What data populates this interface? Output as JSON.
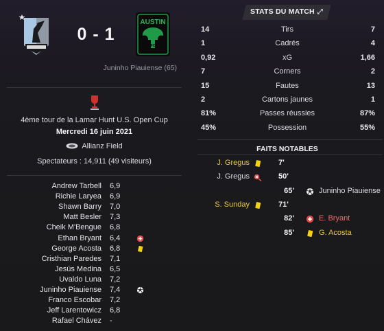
{
  "match": {
    "score": "0 - 1",
    "scorer_note": "Juninho Piauiense (65)",
    "competition": "4ème tour de la Lamar Hunt U.S. Open Cup",
    "date": "Mercredi 16 juin 2021",
    "venue": "Allianz Field",
    "attendance": "Spectateurs : 14,911 (49 visiteurs)",
    "away_crest_text": "AUSTIN",
    "away_crest_sub": "FC",
    "colors": {
      "yellow_card": "#f2d211",
      "red_text": "#ee6b6b",
      "away_green": "#1e9a49",
      "gold_text": "#e8c840"
    }
  },
  "players": [
    {
      "name": "Andrew Tarbell",
      "rating": "6,9",
      "event": ""
    },
    {
      "name": "Richie Laryea",
      "rating": "6,9",
      "event": ""
    },
    {
      "name": "Shawn Barry",
      "rating": "7,0",
      "event": ""
    },
    {
      "name": "Matt Besler",
      "rating": "7,3",
      "event": ""
    },
    {
      "name": "Cheik M'Bengue",
      "rating": "6,8",
      "event": ""
    },
    {
      "name": "Ethan Bryant",
      "rating": "6,4",
      "event": "substitution-red-icon"
    },
    {
      "name": "George Acosta",
      "rating": "6,8",
      "event": "yellow-card-icon"
    },
    {
      "name": "Cristhian Paredes",
      "rating": "7,1",
      "event": ""
    },
    {
      "name": "Jesús Medina",
      "rating": "6,5",
      "event": ""
    },
    {
      "name": "Uvaldo Luna",
      "rating": "7,2",
      "event": ""
    },
    {
      "name": "Juninho Piauiense",
      "rating": "7,4",
      "event": "ball-icon"
    },
    {
      "name": "Franco Escobar",
      "rating": "7,2",
      "event": ""
    },
    {
      "name": "Jeff Larentowicz",
      "rating": "6,8",
      "event": ""
    },
    {
      "name": "Rafael Chávez",
      "rating": "-",
      "event": ""
    }
  ],
  "stats": {
    "title": "STATS DU MATCH",
    "rows": [
      {
        "home": "14",
        "label": "Tirs",
        "away": "7"
      },
      {
        "home": "1",
        "label": "Cadrés",
        "away": "4"
      },
      {
        "home": "0,92",
        "label": "xG",
        "away": "1,66"
      },
      {
        "home": "7",
        "label": "Corners",
        "away": "2"
      },
      {
        "home": "15",
        "label": "Fautes",
        "away": "13"
      },
      {
        "home": "2",
        "label": "Cartons jaunes",
        "away": "1"
      },
      {
        "home": "81%",
        "label": "Passes réussies",
        "away": "87%"
      },
      {
        "home": "45%",
        "label": "Possession",
        "away": "55%"
      }
    ]
  },
  "events": {
    "title": "FAITS NOTABLES",
    "rows": [
      {
        "minute": "7'",
        "home_name": "J. Gregus",
        "home_icon": "yellow-card-icon",
        "away_name": "",
        "away_icon": "",
        "name_color": "gold"
      },
      {
        "minute": "50'",
        "home_name": "J. Gregus",
        "home_icon": "missed-chance-icon",
        "away_name": "",
        "away_icon": "",
        "name_color": "white"
      },
      {
        "minute": "65'",
        "home_name": "",
        "home_icon": "",
        "away_name": "Juninho Piauiense",
        "away_icon": "ball-icon",
        "name_color": "white"
      },
      {
        "minute": "71'",
        "home_name": "S. Sunday",
        "home_icon": "yellow-card-icon",
        "away_name": "",
        "away_icon": "",
        "name_color": "gold"
      },
      {
        "minute": "82'",
        "home_name": "",
        "home_icon": "",
        "away_name": "E. Bryant",
        "away_icon": "substitution-red-icon",
        "name_color": "red"
      },
      {
        "minute": "85'",
        "home_name": "",
        "home_icon": "",
        "away_name": "G. Acosta",
        "away_icon": "yellow-card-icon",
        "name_color": "gold"
      }
    ]
  }
}
